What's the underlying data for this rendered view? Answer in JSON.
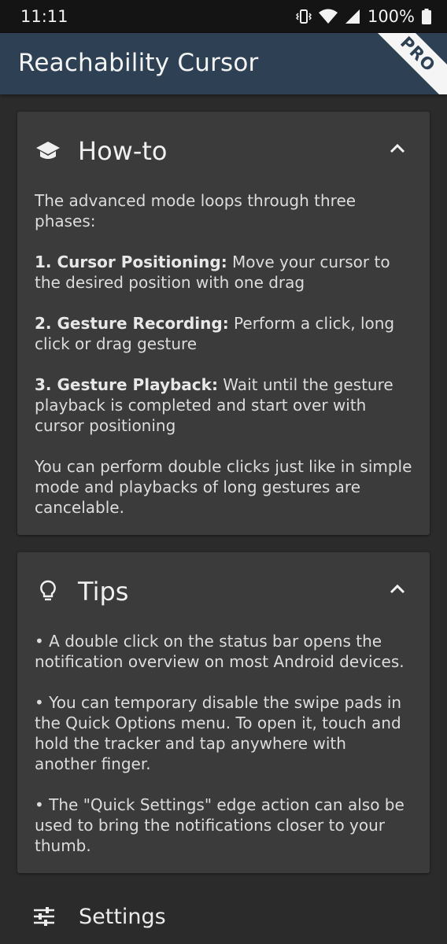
{
  "status_bar": {
    "time": "11:11",
    "battery": "100%"
  },
  "app_bar": {
    "title": "Reachability Cursor",
    "badge": "PRO"
  },
  "howto": {
    "title": "How-to",
    "intro": "The advanced mode loops through three phases:",
    "steps": [
      {
        "label": "1. Cursor Positioning:",
        "text": " Move your cursor to the desired position with one drag"
      },
      {
        "label": "2. Gesture Recording:",
        "text": " Perform a click, long click or drag gesture"
      },
      {
        "label": "3. Gesture Playback:",
        "text": " Wait until the gesture playback is completed and start over with cursor positioning"
      }
    ],
    "outro": "You can perform double clicks just like in simple mode and playbacks of long gestures are cancelable."
  },
  "tips": {
    "title": "Tips",
    "items": [
      "• A double click on the status bar opens the notification overview on most Android devices.",
      "• You can temporary disable the swipe pads in the Quick Options menu. To open it, touch and hold the tracker and tap anywhere with another finger.",
      "• The \"Quick Settings\" edge action can also be used to bring the notifications closer to your thumb."
    ]
  },
  "settings": {
    "label": "Settings"
  },
  "colors": {
    "app_bar": "#2e4154",
    "card": "#3b3b3b",
    "background": "#2b2b2b"
  },
  "icons": {
    "howto": "graduation-cap-icon",
    "tips": "lightbulb-icon",
    "settings": "sliders-icon",
    "collapse": "chevron-up-icon"
  }
}
